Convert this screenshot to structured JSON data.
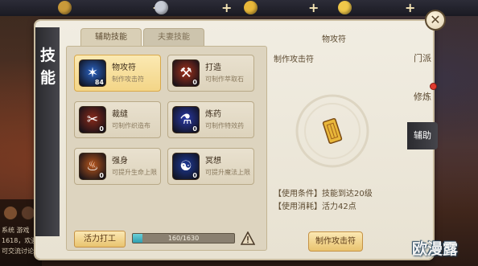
{
  "panel_title": [
    "技",
    "能"
  ],
  "tabs": {
    "active": "辅助技能",
    "inactive": "夫妻技能"
  },
  "skills": [
    {
      "name": "物攻符",
      "desc": "制作攻击符",
      "level": "84",
      "icon": "talisman-attack-icon",
      "color": "#2a63c4",
      "glyph": "✶",
      "selected": true
    },
    {
      "name": "打造",
      "desc": "可制作萃取石",
      "level": "0",
      "icon": "forge-anvil-icon",
      "color": "#a4321c",
      "glyph": "⚒",
      "selected": false
    },
    {
      "name": "裁缝",
      "desc": "可制作织造布",
      "level": "0",
      "icon": "tailor-spool-icon",
      "color": "#8a2a1a",
      "glyph": "✂",
      "selected": false
    },
    {
      "name": "炼药",
      "desc": "可制作特效药",
      "level": "0",
      "icon": "alchemy-potion-icon",
      "color": "#2a3aa8",
      "glyph": "⚗",
      "selected": false
    },
    {
      "name": "强身",
      "desc": "可提升生命上限",
      "level": "0",
      "icon": "strength-body-icon",
      "color": "#b8561c",
      "glyph": "♨",
      "selected": false
    },
    {
      "name": "冥想",
      "desc": "可提升魔法上限",
      "level": "0",
      "icon": "meditation-icon",
      "color": "#1e3a9a",
      "glyph": "☯",
      "selected": false
    }
  ],
  "bottom": {
    "work_button": "活力打工",
    "vitality_text": "160/1630",
    "vitality_fraction": 0.098
  },
  "detail": {
    "title": "物攻符",
    "subtitle": "制作攻击符",
    "condition": "【使用条件】技能到达20级",
    "cost": "【使用消耗】活力42点",
    "make_button": "制作攻击符"
  },
  "side_tabs": [
    "门派",
    "修炼",
    "辅助"
  ],
  "active_side_tab": 2,
  "chat": {
    "tag": "系统",
    "lines": [
      "系统  游戏",
      "1618，欢迎",
      "可交流讨论"
    ]
  },
  "watermark": "欧漫露",
  "colors": {
    "accent": "#f3d587",
    "panel": "#ece6d8",
    "vitality": "#3fb0c0"
  }
}
